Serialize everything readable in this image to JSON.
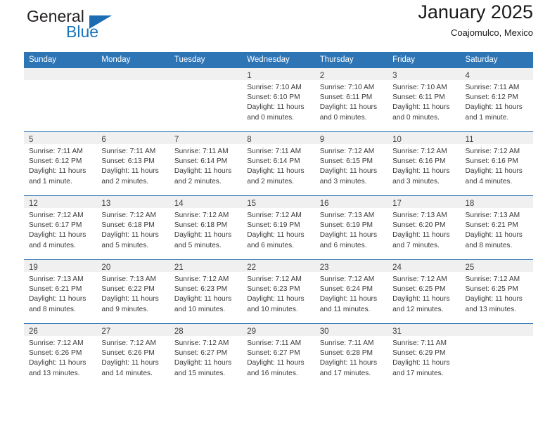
{
  "brand": {
    "name_top": "General",
    "name_bottom": "Blue",
    "logo_icon": "triangle-logo-icon",
    "accent_color": "#1b75bb"
  },
  "header": {
    "title": "January 2025",
    "subtitle": "Coajomulco, Mexico"
  },
  "theme": {
    "header_bg": "#2e75b6",
    "daynum_bg": "#f0f0f0",
    "row_divider": "#2e75b6",
    "text": "#3a3a3a"
  },
  "weekday_headers": [
    "Sunday",
    "Monday",
    "Tuesday",
    "Wednesday",
    "Thursday",
    "Friday",
    "Saturday"
  ],
  "weeks": [
    [
      {
        "day": "",
        "sunrise": "",
        "sunset": "",
        "daylight_1": "",
        "daylight_2": "",
        "empty": true
      },
      {
        "day": "",
        "sunrise": "",
        "sunset": "",
        "daylight_1": "",
        "daylight_2": "",
        "empty": true
      },
      {
        "day": "",
        "sunrise": "",
        "sunset": "",
        "daylight_1": "",
        "daylight_2": "",
        "empty": true
      },
      {
        "day": "1",
        "sunrise": "Sunrise: 7:10 AM",
        "sunset": "Sunset: 6:10 PM",
        "daylight_1": "Daylight: 11 hours",
        "daylight_2": "and 0 minutes."
      },
      {
        "day": "2",
        "sunrise": "Sunrise: 7:10 AM",
        "sunset": "Sunset: 6:11 PM",
        "daylight_1": "Daylight: 11 hours",
        "daylight_2": "and 0 minutes."
      },
      {
        "day": "3",
        "sunrise": "Sunrise: 7:10 AM",
        "sunset": "Sunset: 6:11 PM",
        "daylight_1": "Daylight: 11 hours",
        "daylight_2": "and 0 minutes."
      },
      {
        "day": "4",
        "sunrise": "Sunrise: 7:11 AM",
        "sunset": "Sunset: 6:12 PM",
        "daylight_1": "Daylight: 11 hours",
        "daylight_2": "and 1 minute."
      }
    ],
    [
      {
        "day": "5",
        "sunrise": "Sunrise: 7:11 AM",
        "sunset": "Sunset: 6:12 PM",
        "daylight_1": "Daylight: 11 hours",
        "daylight_2": "and 1 minute."
      },
      {
        "day": "6",
        "sunrise": "Sunrise: 7:11 AM",
        "sunset": "Sunset: 6:13 PM",
        "daylight_1": "Daylight: 11 hours",
        "daylight_2": "and 2 minutes."
      },
      {
        "day": "7",
        "sunrise": "Sunrise: 7:11 AM",
        "sunset": "Sunset: 6:14 PM",
        "daylight_1": "Daylight: 11 hours",
        "daylight_2": "and 2 minutes."
      },
      {
        "day": "8",
        "sunrise": "Sunrise: 7:11 AM",
        "sunset": "Sunset: 6:14 PM",
        "daylight_1": "Daylight: 11 hours",
        "daylight_2": "and 2 minutes."
      },
      {
        "day": "9",
        "sunrise": "Sunrise: 7:12 AM",
        "sunset": "Sunset: 6:15 PM",
        "daylight_1": "Daylight: 11 hours",
        "daylight_2": "and 3 minutes."
      },
      {
        "day": "10",
        "sunrise": "Sunrise: 7:12 AM",
        "sunset": "Sunset: 6:16 PM",
        "daylight_1": "Daylight: 11 hours",
        "daylight_2": "and 3 minutes."
      },
      {
        "day": "11",
        "sunrise": "Sunrise: 7:12 AM",
        "sunset": "Sunset: 6:16 PM",
        "daylight_1": "Daylight: 11 hours",
        "daylight_2": "and 4 minutes."
      }
    ],
    [
      {
        "day": "12",
        "sunrise": "Sunrise: 7:12 AM",
        "sunset": "Sunset: 6:17 PM",
        "daylight_1": "Daylight: 11 hours",
        "daylight_2": "and 4 minutes."
      },
      {
        "day": "13",
        "sunrise": "Sunrise: 7:12 AM",
        "sunset": "Sunset: 6:18 PM",
        "daylight_1": "Daylight: 11 hours",
        "daylight_2": "and 5 minutes."
      },
      {
        "day": "14",
        "sunrise": "Sunrise: 7:12 AM",
        "sunset": "Sunset: 6:18 PM",
        "daylight_1": "Daylight: 11 hours",
        "daylight_2": "and 5 minutes."
      },
      {
        "day": "15",
        "sunrise": "Sunrise: 7:12 AM",
        "sunset": "Sunset: 6:19 PM",
        "daylight_1": "Daylight: 11 hours",
        "daylight_2": "and 6 minutes."
      },
      {
        "day": "16",
        "sunrise": "Sunrise: 7:13 AM",
        "sunset": "Sunset: 6:19 PM",
        "daylight_1": "Daylight: 11 hours",
        "daylight_2": "and 6 minutes."
      },
      {
        "day": "17",
        "sunrise": "Sunrise: 7:13 AM",
        "sunset": "Sunset: 6:20 PM",
        "daylight_1": "Daylight: 11 hours",
        "daylight_2": "and 7 minutes."
      },
      {
        "day": "18",
        "sunrise": "Sunrise: 7:13 AM",
        "sunset": "Sunset: 6:21 PM",
        "daylight_1": "Daylight: 11 hours",
        "daylight_2": "and 8 minutes."
      }
    ],
    [
      {
        "day": "19",
        "sunrise": "Sunrise: 7:13 AM",
        "sunset": "Sunset: 6:21 PM",
        "daylight_1": "Daylight: 11 hours",
        "daylight_2": "and 8 minutes."
      },
      {
        "day": "20",
        "sunrise": "Sunrise: 7:13 AM",
        "sunset": "Sunset: 6:22 PM",
        "daylight_1": "Daylight: 11 hours",
        "daylight_2": "and 9 minutes."
      },
      {
        "day": "21",
        "sunrise": "Sunrise: 7:12 AM",
        "sunset": "Sunset: 6:23 PM",
        "daylight_1": "Daylight: 11 hours",
        "daylight_2": "and 10 minutes."
      },
      {
        "day": "22",
        "sunrise": "Sunrise: 7:12 AM",
        "sunset": "Sunset: 6:23 PM",
        "daylight_1": "Daylight: 11 hours",
        "daylight_2": "and 10 minutes."
      },
      {
        "day": "23",
        "sunrise": "Sunrise: 7:12 AM",
        "sunset": "Sunset: 6:24 PM",
        "daylight_1": "Daylight: 11 hours",
        "daylight_2": "and 11 minutes."
      },
      {
        "day": "24",
        "sunrise": "Sunrise: 7:12 AM",
        "sunset": "Sunset: 6:25 PM",
        "daylight_1": "Daylight: 11 hours",
        "daylight_2": "and 12 minutes."
      },
      {
        "day": "25",
        "sunrise": "Sunrise: 7:12 AM",
        "sunset": "Sunset: 6:25 PM",
        "daylight_1": "Daylight: 11 hours",
        "daylight_2": "and 13 minutes."
      }
    ],
    [
      {
        "day": "26",
        "sunrise": "Sunrise: 7:12 AM",
        "sunset": "Sunset: 6:26 PM",
        "daylight_1": "Daylight: 11 hours",
        "daylight_2": "and 13 minutes."
      },
      {
        "day": "27",
        "sunrise": "Sunrise: 7:12 AM",
        "sunset": "Sunset: 6:26 PM",
        "daylight_1": "Daylight: 11 hours",
        "daylight_2": "and 14 minutes."
      },
      {
        "day": "28",
        "sunrise": "Sunrise: 7:12 AM",
        "sunset": "Sunset: 6:27 PM",
        "daylight_1": "Daylight: 11 hours",
        "daylight_2": "and 15 minutes."
      },
      {
        "day": "29",
        "sunrise": "Sunrise: 7:11 AM",
        "sunset": "Sunset: 6:27 PM",
        "daylight_1": "Daylight: 11 hours",
        "daylight_2": "and 16 minutes."
      },
      {
        "day": "30",
        "sunrise": "Sunrise: 7:11 AM",
        "sunset": "Sunset: 6:28 PM",
        "daylight_1": "Daylight: 11 hours",
        "daylight_2": "and 17 minutes."
      },
      {
        "day": "31",
        "sunrise": "Sunrise: 7:11 AM",
        "sunset": "Sunset: 6:29 PM",
        "daylight_1": "Daylight: 11 hours",
        "daylight_2": "and 17 minutes."
      },
      {
        "day": "",
        "sunrise": "",
        "sunset": "",
        "daylight_1": "",
        "daylight_2": "",
        "empty": true,
        "blank": true
      }
    ]
  ]
}
